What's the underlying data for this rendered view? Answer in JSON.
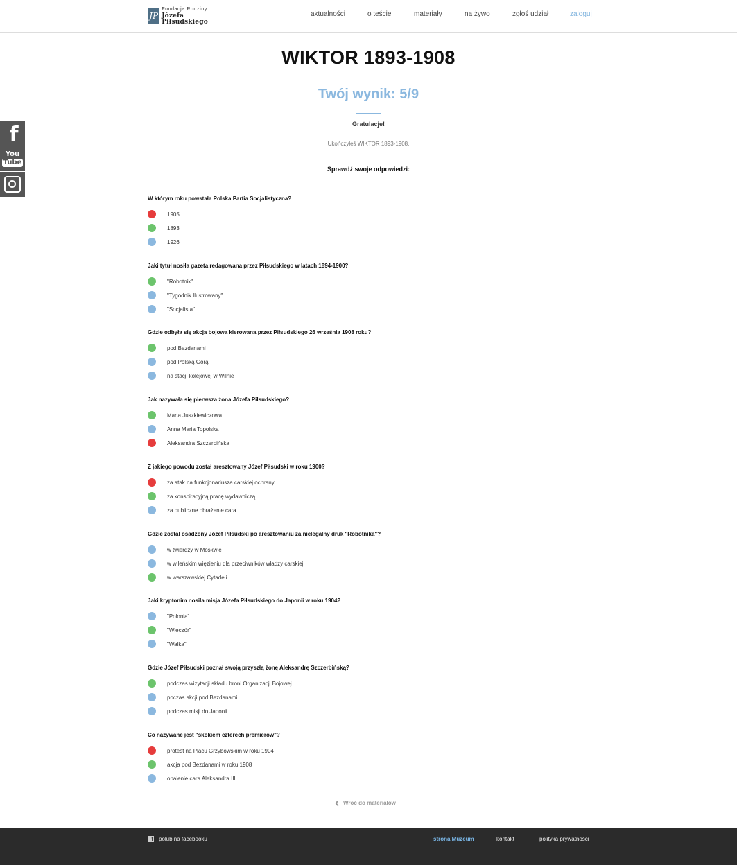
{
  "header": {
    "logo_line1": "Fundacja Rodziny",
    "logo_line2": "Józefa Piłsudskiego",
    "logo_mark": "JP",
    "nav": [
      "aktualności",
      "o teście",
      "materiały",
      "na żywo",
      "zgłoś udział",
      "zaloguj"
    ]
  },
  "social": {
    "facebook_glyph": "f",
    "youtube_top": "You",
    "youtube_bottom": "Tube"
  },
  "quiz": {
    "title": "WIKTOR 1893-1908",
    "score": "Twój wynik: 5/9",
    "congrats": "Gratulacje!",
    "completed": "Ukończyłeś WIKTOR 1893-1908.",
    "check": "Sprawdź swoje odpowiedzi:",
    "status_colors": {
      "wrong": "#e63c3c",
      "correct": "#6cc46c",
      "neutral": "#8bb8df"
    },
    "questions": [
      {
        "text": "W którym roku powstała Polska Partia Socjalistyczna?",
        "answers": [
          {
            "text": "1905",
            "status": "wrong"
          },
          {
            "text": "1893",
            "status": "correct"
          },
          {
            "text": "1926",
            "status": "neutral"
          }
        ]
      },
      {
        "text": "Jaki tytuł nosiła gazeta redagowana przez Piłsudskiego w latach 1894-1900?",
        "answers": [
          {
            "text": "\"Robotnik\"",
            "status": "correct"
          },
          {
            "text": "\"Tygodnik Ilustrowany\"",
            "status": "neutral"
          },
          {
            "text": "\"Socjalista\"",
            "status": "neutral"
          }
        ]
      },
      {
        "text": "Gdzie odbyła się akcja bojowa kierowana przez Piłsudskiego 26 września 1908 roku?",
        "answers": [
          {
            "text": "pod Bezdanami",
            "status": "correct"
          },
          {
            "text": "pod Polską Górą",
            "status": "neutral"
          },
          {
            "text": "na stacji kolejowej w Wilnie",
            "status": "neutral"
          }
        ]
      },
      {
        "text": "Jak nazywała się pierwsza żona Józefa Piłsudskiego?",
        "answers": [
          {
            "text": "Maria Juszkiewiczowa",
            "status": "correct"
          },
          {
            "text": "Anna Maria Topolska",
            "status": "neutral"
          },
          {
            "text": "Aleksandra Szczerbińska",
            "status": "wrong"
          }
        ]
      },
      {
        "text": "Z jakiego powodu został aresztowany Józef Piłsudski w roku 1900?",
        "answers": [
          {
            "text": "za atak na funkcjonariusza carskiej ochrany",
            "status": "wrong"
          },
          {
            "text": "za konspiracyjną pracę wydawniczą",
            "status": "correct"
          },
          {
            "text": "za publiczne obrażenie cara",
            "status": "neutral"
          }
        ]
      },
      {
        "text": "Gdzie został osadzony Józef Piłsudski po aresztowaniu za nielegalny druk \"Robotnika\"?",
        "answers": [
          {
            "text": "w twierdzy w Moskwie",
            "status": "neutral"
          },
          {
            "text": "w wileńskim więzieniu dla przeciwników władzy carskiej",
            "status": "neutral"
          },
          {
            "text": "w warszawskiej Cytadeli",
            "status": "correct"
          }
        ]
      },
      {
        "text": "Jaki kryptonim nosiła misja Józefa Piłsudskiego do Japonii w roku 1904?",
        "answers": [
          {
            "text": "\"Polonia\"",
            "status": "neutral"
          },
          {
            "text": "\"Wieczór\"",
            "status": "correct"
          },
          {
            "text": "\"Walka\"",
            "status": "neutral"
          }
        ]
      },
      {
        "text": "Gdzie Józef Piłsudski poznał swoją przyszłą żonę Aleksandrę Szczerbińską?",
        "answers": [
          {
            "text": "podczas wizytacji składu broni Organizacji Bojowej",
            "status": "correct"
          },
          {
            "text": "poczas akcji pod Bezdanami",
            "status": "neutral"
          },
          {
            "text": "podczas misji do Japonii",
            "status": "neutral"
          }
        ]
      },
      {
        "text": "Co nazywane jest \"skokiem czterech premierów\"?",
        "answers": [
          {
            "text": "protest na Placu Grzybowskim w roku 1904",
            "status": "wrong"
          },
          {
            "text": "akcja pod Bezdanami w roku 1908",
            "status": "correct"
          },
          {
            "text": "obalenie cara Aleksandra III",
            "status": "neutral"
          }
        ]
      }
    ],
    "back_label": "Wróć do materiałów"
  },
  "footer": {
    "facebook": "polub na facebooku",
    "facebook_icon": "f",
    "museum": "strona Muzeum",
    "contact": "kontakt",
    "privacy": "polityka prywatności"
  }
}
